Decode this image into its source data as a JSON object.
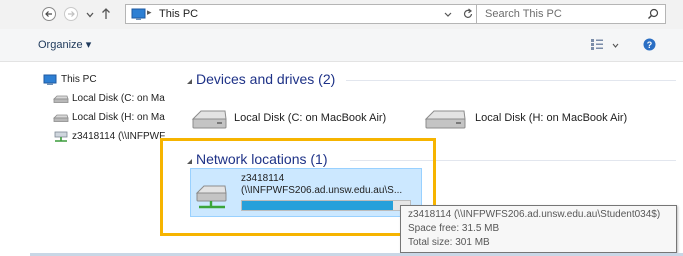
{
  "nav_buttons": {
    "back_icon": "back-arrow-icon",
    "forward_icon": "forward-arrow-icon",
    "recent_icon": "chevron-down-icon",
    "up_icon": "up-arrow-icon"
  },
  "address_bar": {
    "location": "This PC",
    "separator": "▸"
  },
  "search": {
    "placeholder": "Search This PC"
  },
  "toolbar": {
    "organize_label": "Organize ▾",
    "view_icon": "view-options-icon",
    "help_icon": "help-icon"
  },
  "sidebar": {
    "items": [
      {
        "label": "This PC"
      },
      {
        "label": "Local Disk (C: on Ma"
      },
      {
        "label": "Local Disk (H: on Ma"
      },
      {
        "label": "z3418114 (\\\\INFPWF"
      }
    ]
  },
  "groups": {
    "devices": {
      "header": "Devices and drives (2)"
    },
    "network": {
      "header": "Network locations (1)"
    }
  },
  "drives": [
    {
      "label": "Local Disk (C: on MacBook Air)"
    },
    {
      "label": "Local Disk (H: on MacBook Air)"
    }
  ],
  "network_drive": {
    "name": "z3418114",
    "path": "(\\\\INFPWFS206.ad.unsw.edu.au\\S...",
    "usage_fraction": 0.9
  },
  "tooltip": {
    "line1": "z3418114 (\\\\INFPWFS206.ad.unsw.edu.au\\Student034$)",
    "line2": "Space free: 31.5 MB",
    "line3": "Total size: 301 MB"
  },
  "colors": {
    "accent_highlight": "#f6b400",
    "group_header": "#1e3287",
    "selection": "#cce8ff",
    "usage_bar": "#26a0da"
  }
}
